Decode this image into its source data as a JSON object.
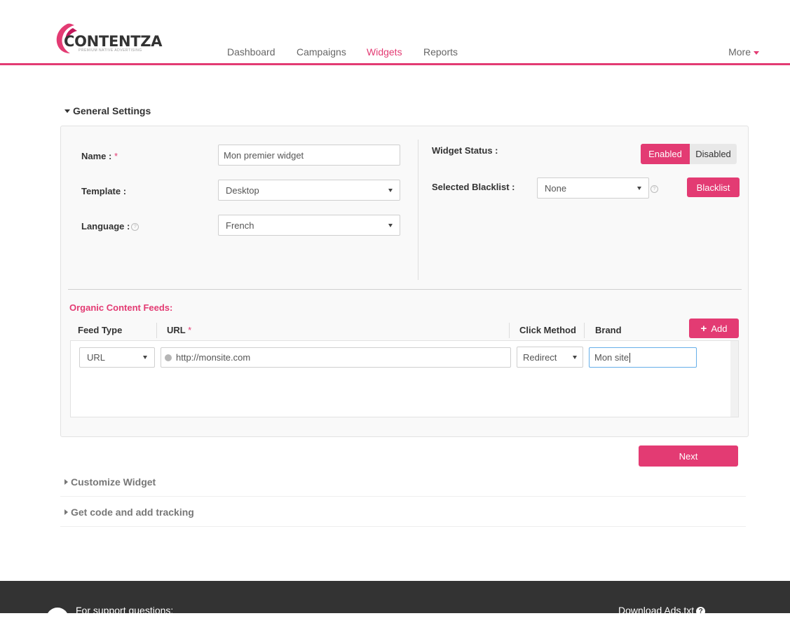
{
  "header": {
    "logo_text": "CONTENTZA",
    "logo_tagline": "PREMIUM NATIVE ADVERTISING",
    "nav": [
      {
        "label": "Dashboard"
      },
      {
        "label": "Campaigns"
      },
      {
        "label": "Widgets"
      },
      {
        "label": "Reports"
      }
    ],
    "more_label": "More"
  },
  "general_settings": {
    "title": "General Settings",
    "name_label": "Name :",
    "name_required": "*",
    "name_value": "Mon premier widget",
    "template_label": "Template :",
    "template_value": "Desktop",
    "language_label": "Language :",
    "language_value": "French",
    "help_symbol": "?",
    "widget_status_label": "Widget Status :",
    "status_enabled": "Enabled",
    "status_disabled": "Disabled",
    "blacklist_label": "Selected Blacklist :",
    "blacklist_value": "None",
    "blacklist_button": "Blacklist"
  },
  "feeds": {
    "title": "Organic Content Feeds:",
    "headers": {
      "feed_type": "Feed Type",
      "url": "URL",
      "url_required": "*",
      "click_method": "Click Method",
      "brand": "Brand"
    },
    "add_button": "Add",
    "rows": [
      {
        "feed_type": "URL",
        "url": "http://monsite.com",
        "click_method": "Redirect",
        "brand": "Mon site"
      }
    ]
  },
  "next_button": "Next",
  "customize_widget": "Customize Widget",
  "get_code": "Get code and add tracking",
  "footer": {
    "support": "For support questions:",
    "download": "Download Ads.txt",
    "help_symbol": "?"
  },
  "colors": {
    "brand": "#e33b73",
    "footer_bg": "#333333"
  }
}
